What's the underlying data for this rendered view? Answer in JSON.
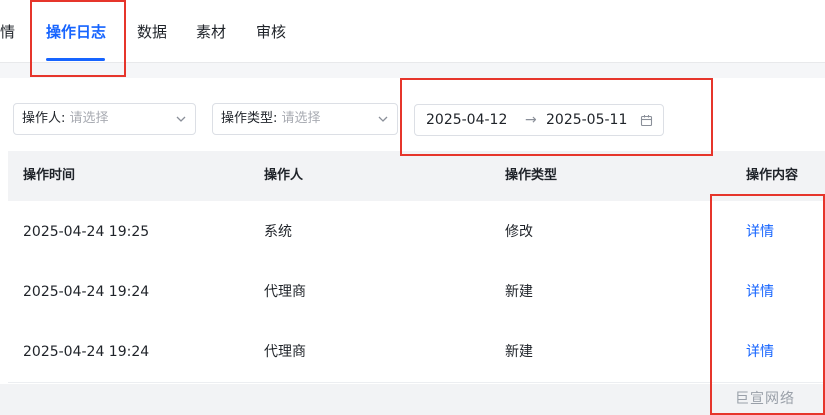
{
  "tabs": [
    {
      "label": "情",
      "active": false
    },
    {
      "label": "操作日志",
      "active": true
    },
    {
      "label": "数据",
      "active": false
    },
    {
      "label": "素材",
      "active": false
    },
    {
      "label": "审核",
      "active": false
    }
  ],
  "filters": {
    "operator_label": "操作人:",
    "operator_placeholder": "请选择",
    "type_label": "操作类型:",
    "type_placeholder": "请选择",
    "date_start": "2025-04-12",
    "date_separator": "→",
    "date_end": "2025-05-11"
  },
  "table": {
    "headers": [
      "操作时间",
      "操作人",
      "操作类型",
      "操作内容"
    ],
    "rows": [
      {
        "time": "2025-04-24 19:25",
        "operator": "系统",
        "type": "修改",
        "action": "详情"
      },
      {
        "time": "2025-04-24 19:24",
        "operator": "代理商",
        "type": "新建",
        "action": "详情"
      },
      {
        "time": "2025-04-24 19:24",
        "operator": "代理商",
        "type": "新建",
        "action": "详情"
      }
    ]
  },
  "brand": "巨宣网络",
  "colors": {
    "accent": "#1664ff",
    "annotation": "#e6352b"
  },
  "icons": [
    "chevron-down-icon",
    "calendar-icon"
  ]
}
